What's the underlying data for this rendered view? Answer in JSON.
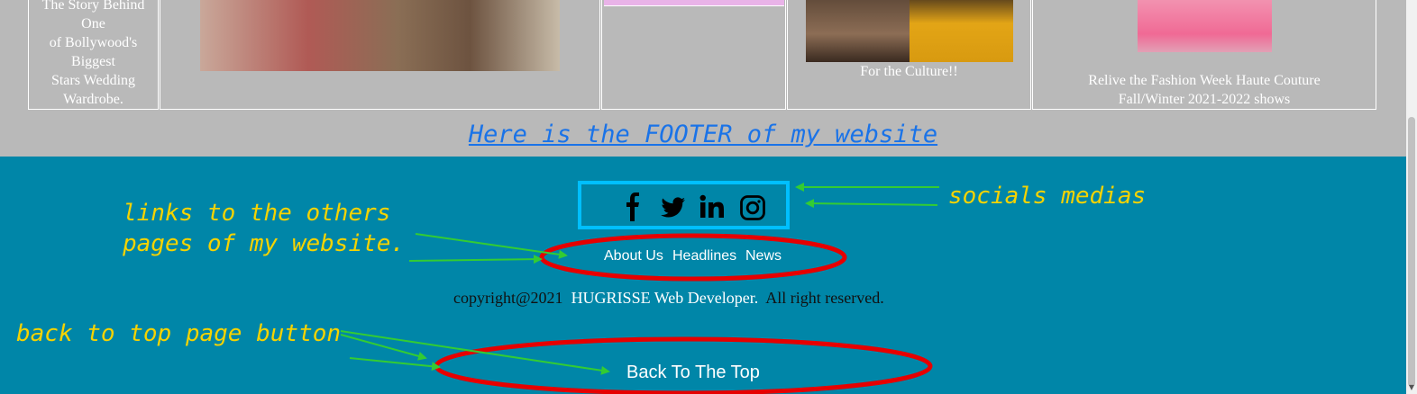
{
  "gallery": {
    "cell1_lines": [
      "The Story Behind",
      "One",
      "of Bollywood's",
      "Biggest",
      "Stars Wedding",
      "Wardrobe."
    ],
    "cell4_caption": "For the Culture!!",
    "cell5_caption_line1": "Relive the Fashion Week Haute Couture",
    "cell5_caption_line2": "Fall/Winter 2021-2022 shows"
  },
  "footer": {
    "heading": "Here is the FOOTER of my website",
    "socials": [
      "facebook-icon",
      "twitter-icon",
      "linkedin-icon",
      "instagram-icon"
    ],
    "nav": [
      "About Us",
      "Headlines",
      "News"
    ],
    "copyright_prefix": "copyright@2021",
    "copyright_brand": "HUGRISSE Web Developer.",
    "copyright_suffix": "All right reserved.",
    "back_to_top": "Back To The Top"
  },
  "annotations": {
    "links_line1": "links to the others",
    "links_line2": "pages of my website.",
    "socials": "socials medias",
    "back_top": "back to top page button"
  },
  "colors": {
    "page_bg": "#b9b9b9",
    "footer_bg": "#0086a8",
    "heading_link": "#1a73e8",
    "annotation": "#f5d300",
    "socials_border": "#00bfff",
    "ellipse": "#e60000",
    "arrow": "#33cc33"
  }
}
